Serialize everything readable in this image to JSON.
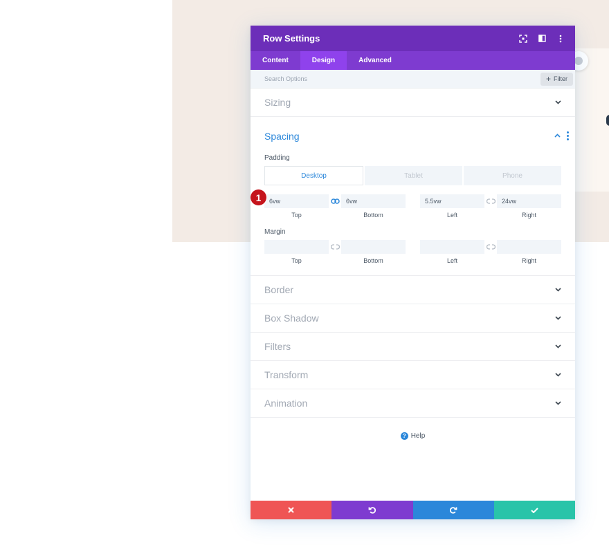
{
  "modal": {
    "title": "Row Settings",
    "tabs": [
      {
        "label": "Content",
        "active": false
      },
      {
        "label": "Design",
        "active": true
      },
      {
        "label": "Advanced",
        "active": false
      }
    ]
  },
  "search": {
    "placeholder": "Search Options",
    "filter_label": "Filter"
  },
  "sections": {
    "sizing": "Sizing",
    "spacing": "Spacing",
    "border": "Border",
    "box_shadow": "Box Shadow",
    "filters": "Filters",
    "transform": "Transform",
    "animation": "Animation"
  },
  "spacing": {
    "padding_label": "Padding",
    "device_tabs": [
      "Desktop",
      "Tablet",
      "Phone"
    ],
    "padding": {
      "top": "6vw",
      "bottom": "6vw",
      "left": "5.5vw",
      "right": "24vw",
      "top_label": "Top",
      "bottom_label": "Bottom",
      "left_label": "Left",
      "right_label": "Right"
    },
    "margin_label": "Margin",
    "margin": {
      "top": "",
      "bottom": "",
      "left": "",
      "right": "",
      "top_label": "Top",
      "bottom_label": "Bottom",
      "left_label": "Left",
      "right_label": "Right"
    }
  },
  "step_badge": "1",
  "help_label": "Help",
  "colors": {
    "header": "#6c2eb9",
    "tabs": "#7e3bd0",
    "active_tab": "#8f42ec",
    "accent": "#2b87da",
    "cancel": "#ef5555",
    "undo": "#7e3bd0",
    "redo": "#2b87da",
    "save": "#29c4a9"
  },
  "icons": {
    "header": [
      "fullscreen-icon",
      "split-view-icon",
      "more-icon"
    ],
    "footer": [
      "close-icon",
      "undo-icon",
      "redo-icon",
      "check-icon"
    ]
  }
}
